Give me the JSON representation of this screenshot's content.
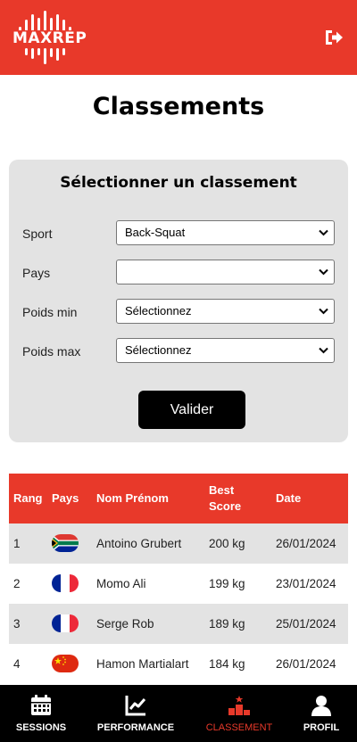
{
  "header": {
    "logo_text": "MAXREP",
    "brand_color": "#e8392a",
    "logout_icon": "logout-icon"
  },
  "page": {
    "title": "Classements"
  },
  "filter": {
    "title": "Sélectionner un classement",
    "fields": [
      {
        "label": "Sport",
        "value": "Back-Squat"
      },
      {
        "label": "Pays",
        "value": ""
      },
      {
        "label": "Poids min",
        "value": "Sélectionnez"
      },
      {
        "label": "Poids max",
        "value": "Sélectionnez"
      }
    ],
    "submit_label": "Valider"
  },
  "table": {
    "headers": {
      "rang": "Rang",
      "pays": "Pays",
      "nom": "Nom Prénom",
      "best": "Best Score",
      "date": "Date"
    },
    "rows": [
      {
        "rang": "1",
        "flag": "south-africa-flag",
        "nom": "Antoino Grubert",
        "best": "200 kg",
        "date": "26/01/2024"
      },
      {
        "rang": "2",
        "flag": "france-flag",
        "nom": "Momo Ali",
        "best": "199 kg",
        "date": "23/01/2024"
      },
      {
        "rang": "3",
        "flag": "france-flag",
        "nom": "Serge Rob",
        "best": "189 kg",
        "date": "25/01/2024"
      },
      {
        "rang": "4",
        "flag": "china-flag",
        "nom": "Hamon Martialart",
        "best": "184 kg",
        "date": "26/01/2024"
      }
    ]
  },
  "nav": {
    "items": [
      {
        "label": "SESSIONS",
        "icon": "calendar-icon"
      },
      {
        "label": "PERFORMANCE",
        "icon": "chart-line-icon"
      },
      {
        "label": "CLASSEMENT",
        "icon": "podium-icon",
        "active": true
      },
      {
        "label": "PROFIL",
        "icon": "user-icon"
      }
    ]
  }
}
